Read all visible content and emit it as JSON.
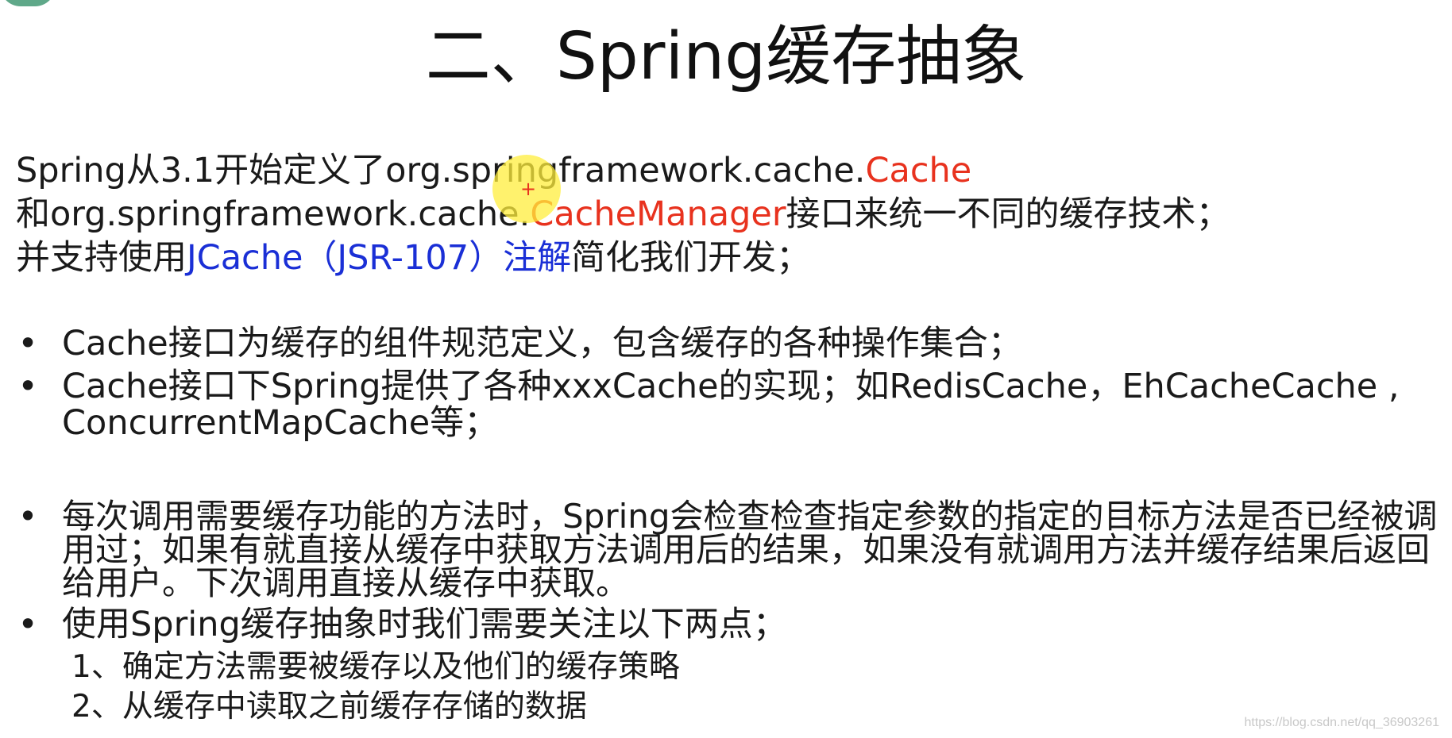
{
  "slide": {
    "title": "二、Spring缓存抽象",
    "intro": {
      "line1": {
        "prefix": "Spring从3.1开始定义了org.springframework.cache.",
        "highlight": "Cache"
      },
      "line2": {
        "prefix": "和org.springframework.cache.",
        "highlight": "CacheManager",
        "suffix": "接口来统一不同的缓存技术；"
      },
      "line3": {
        "prefix": "并支持使用",
        "highlight": "JCache（JSR-107）注解",
        "suffix": "简化我们开发；"
      }
    },
    "bullets": [
      "Cache接口为缓存的组件规范定义，包含缓存的各种操作集合；",
      "Cache接口下Spring提供了各种xxxCache的实现；如RedisCache，EhCacheCache , ConcurrentMapCache等；",
      "每次调用需要缓存功能的方法时，Spring会检查检查指定参数的指定的目标方法是否已经被调用过；如果有就直接从缓存中获取方法调用后的结果，如果没有就调用方法并缓存结果后返回给用户。下次调用直接从缓存中获取。",
      "使用Spring缓存抽象时我们需要关注以下两点；"
    ],
    "sub_points": [
      "1、确定方法需要被缓存以及他们的缓存策略",
      "2、从缓存中读取之前缓存存储的数据"
    ],
    "bullet_symbol": "•",
    "cursor_symbol": "+",
    "watermark": "https://blog.csdn.net/qq_36903261"
  },
  "colors": {
    "highlight_red": "#e8321e",
    "highlight_blue": "#1a2fd6",
    "text": "#1a1a1a",
    "cursor_yellow": "#ffee3c"
  }
}
